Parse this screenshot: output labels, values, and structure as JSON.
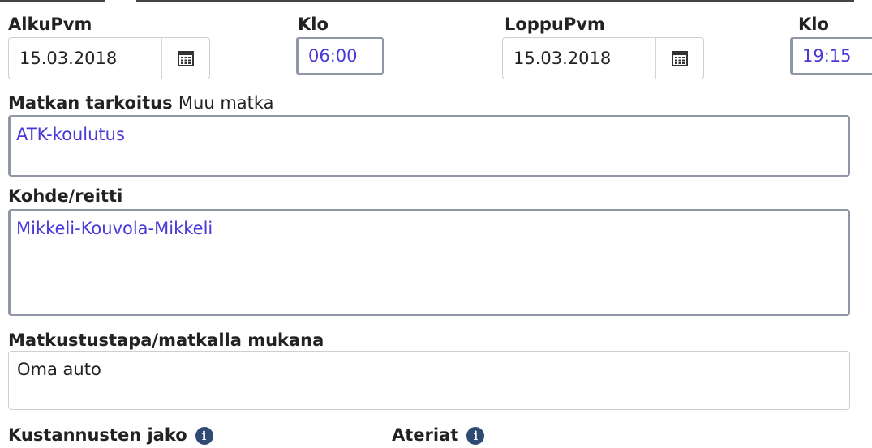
{
  "start": {
    "date_label": "AlkuPvm",
    "date_value": "15.03.2018",
    "time_label": "Klo",
    "time_value": "06:00"
  },
  "end": {
    "date_label": "LoppuPvm",
    "date_value": "15.03.2018",
    "time_label": "Klo",
    "time_value": "19:15"
  },
  "purpose": {
    "label": "Matkan tarkoitus",
    "type": "Muu matka",
    "value": "ATK-koulutus"
  },
  "route": {
    "label": "Kohde/reitti",
    "value": "Mikkeli-Kouvola-Mikkeli"
  },
  "travel_mode": {
    "label": "Matkustustapa/matkalla mukana",
    "value": "Oma auto"
  },
  "cost_sharing": {
    "label": "Kustannusten jako",
    "info_icon": "info-icon"
  },
  "meals": {
    "label": "Ateriat",
    "info_icon": "info-icon"
  },
  "colors": {
    "focus_text": "#4a38d8",
    "label_text": "#222222",
    "info_icon_bg": "#2f4a73",
    "focus_border": "#8f96a6"
  }
}
